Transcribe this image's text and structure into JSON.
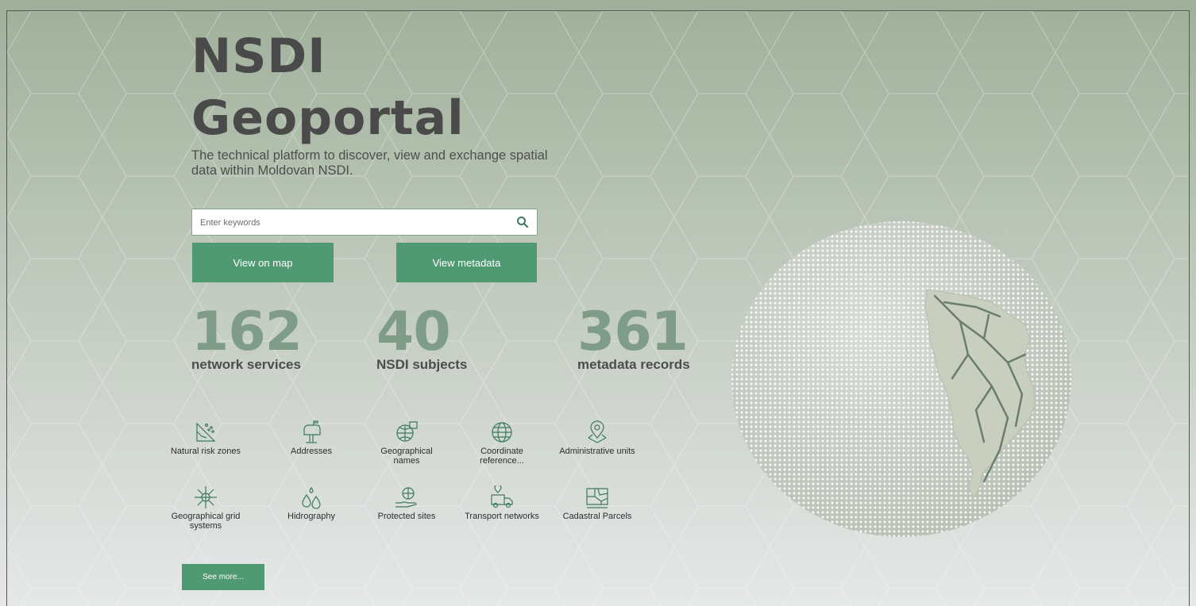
{
  "hero": {
    "title_line1": "NSDI",
    "title_line2": "Geoportal",
    "subtitle": "The technical platform to discover, view and exchange spatial data within Moldovan NSDI."
  },
  "search": {
    "placeholder": "Enter keywords",
    "value": ""
  },
  "buttons": {
    "view_map": "View on map",
    "view_metadata": "View metadata",
    "see_more": "See more..."
  },
  "stats": [
    {
      "number": "162",
      "label": "network services"
    },
    {
      "number": "40",
      "label": "NSDI subjects"
    },
    {
      "number": "361",
      "label": "metadata records"
    }
  ],
  "categories": [
    {
      "label": "Natural risk zones",
      "icon": "natural-risk-icon"
    },
    {
      "label": "Addresses",
      "icon": "mailbox-icon"
    },
    {
      "label": "Geographical names",
      "icon": "map-names-icon"
    },
    {
      "label": "Coordinate reference...",
      "icon": "globe-grid-icon"
    },
    {
      "label": "Administrative units",
      "icon": "location-pin-icon"
    },
    {
      "label": "Geographical grid systems",
      "icon": "grid-network-icon"
    },
    {
      "label": "Hidrography",
      "icon": "water-drops-icon"
    },
    {
      "label": "Protected sites",
      "icon": "hand-globe-icon"
    },
    {
      "label": "Transport networks",
      "icon": "truck-icon"
    },
    {
      "label": "Cadastral Parcels",
      "icon": "cadastral-map-icon"
    }
  ],
  "colors": {
    "accent": "#4f9a72",
    "stat_number": "#7f9c88",
    "title": "#4a4a4a"
  }
}
